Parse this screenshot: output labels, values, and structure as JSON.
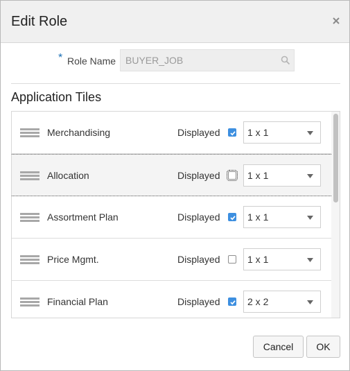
{
  "dialog": {
    "title": "Edit Role",
    "close_icon": "close-icon"
  },
  "role": {
    "required_marker": "*",
    "label": "Role Name",
    "value": "BUYER_JOB",
    "search_icon": "search-icon"
  },
  "section": {
    "title": "Application Tiles"
  },
  "tiles": [
    {
      "name": "Merchandising",
      "displayed_label": "Displayed",
      "displayed": true,
      "size": "1 x 1",
      "selected": false
    },
    {
      "name": "Allocation",
      "displayed_label": "Displayed",
      "displayed": false,
      "size": "1 x 1",
      "selected": true
    },
    {
      "name": "Assortment Plan",
      "displayed_label": "Displayed",
      "displayed": true,
      "size": "1 x 1",
      "selected": false
    },
    {
      "name": "Price Mgmt.",
      "displayed_label": "Displayed",
      "displayed": false,
      "size": "1 x 1",
      "selected": false
    },
    {
      "name": "Financial Plan",
      "displayed_label": "Displayed",
      "displayed": true,
      "size": "2 x 2",
      "selected": false
    }
  ],
  "buttons": {
    "cancel": "Cancel",
    "ok": "OK"
  },
  "colors": {
    "checkbox_checked": "#3d8fe0",
    "required_marker": "#1a6fb5"
  }
}
